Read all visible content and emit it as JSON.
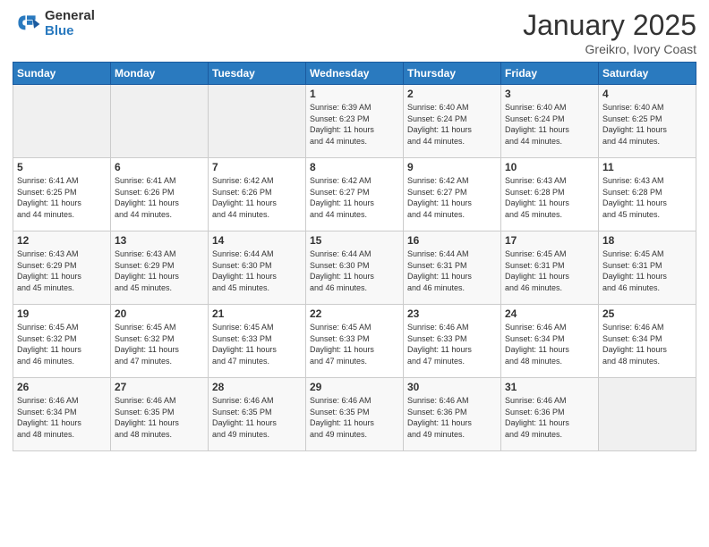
{
  "logo": {
    "general": "General",
    "blue": "Blue"
  },
  "header": {
    "month": "January 2025",
    "location": "Greikro, Ivory Coast"
  },
  "weekdays": [
    "Sunday",
    "Monday",
    "Tuesday",
    "Wednesday",
    "Thursday",
    "Friday",
    "Saturday"
  ],
  "weeks": [
    [
      {
        "day": "",
        "info": ""
      },
      {
        "day": "",
        "info": ""
      },
      {
        "day": "",
        "info": ""
      },
      {
        "day": "1",
        "info": "Sunrise: 6:39 AM\nSunset: 6:23 PM\nDaylight: 11 hours\nand 44 minutes."
      },
      {
        "day": "2",
        "info": "Sunrise: 6:40 AM\nSunset: 6:24 PM\nDaylight: 11 hours\nand 44 minutes."
      },
      {
        "day": "3",
        "info": "Sunrise: 6:40 AM\nSunset: 6:24 PM\nDaylight: 11 hours\nand 44 minutes."
      },
      {
        "day": "4",
        "info": "Sunrise: 6:40 AM\nSunset: 6:25 PM\nDaylight: 11 hours\nand 44 minutes."
      }
    ],
    [
      {
        "day": "5",
        "info": "Sunrise: 6:41 AM\nSunset: 6:25 PM\nDaylight: 11 hours\nand 44 minutes."
      },
      {
        "day": "6",
        "info": "Sunrise: 6:41 AM\nSunset: 6:26 PM\nDaylight: 11 hours\nand 44 minutes."
      },
      {
        "day": "7",
        "info": "Sunrise: 6:42 AM\nSunset: 6:26 PM\nDaylight: 11 hours\nand 44 minutes."
      },
      {
        "day": "8",
        "info": "Sunrise: 6:42 AM\nSunset: 6:27 PM\nDaylight: 11 hours\nand 44 minutes."
      },
      {
        "day": "9",
        "info": "Sunrise: 6:42 AM\nSunset: 6:27 PM\nDaylight: 11 hours\nand 44 minutes."
      },
      {
        "day": "10",
        "info": "Sunrise: 6:43 AM\nSunset: 6:28 PM\nDaylight: 11 hours\nand 45 minutes."
      },
      {
        "day": "11",
        "info": "Sunrise: 6:43 AM\nSunset: 6:28 PM\nDaylight: 11 hours\nand 45 minutes."
      }
    ],
    [
      {
        "day": "12",
        "info": "Sunrise: 6:43 AM\nSunset: 6:29 PM\nDaylight: 11 hours\nand 45 minutes."
      },
      {
        "day": "13",
        "info": "Sunrise: 6:43 AM\nSunset: 6:29 PM\nDaylight: 11 hours\nand 45 minutes."
      },
      {
        "day": "14",
        "info": "Sunrise: 6:44 AM\nSunset: 6:30 PM\nDaylight: 11 hours\nand 45 minutes."
      },
      {
        "day": "15",
        "info": "Sunrise: 6:44 AM\nSunset: 6:30 PM\nDaylight: 11 hours\nand 46 minutes."
      },
      {
        "day": "16",
        "info": "Sunrise: 6:44 AM\nSunset: 6:31 PM\nDaylight: 11 hours\nand 46 minutes."
      },
      {
        "day": "17",
        "info": "Sunrise: 6:45 AM\nSunset: 6:31 PM\nDaylight: 11 hours\nand 46 minutes."
      },
      {
        "day": "18",
        "info": "Sunrise: 6:45 AM\nSunset: 6:31 PM\nDaylight: 11 hours\nand 46 minutes."
      }
    ],
    [
      {
        "day": "19",
        "info": "Sunrise: 6:45 AM\nSunset: 6:32 PM\nDaylight: 11 hours\nand 46 minutes."
      },
      {
        "day": "20",
        "info": "Sunrise: 6:45 AM\nSunset: 6:32 PM\nDaylight: 11 hours\nand 47 minutes."
      },
      {
        "day": "21",
        "info": "Sunrise: 6:45 AM\nSunset: 6:33 PM\nDaylight: 11 hours\nand 47 minutes."
      },
      {
        "day": "22",
        "info": "Sunrise: 6:45 AM\nSunset: 6:33 PM\nDaylight: 11 hours\nand 47 minutes."
      },
      {
        "day": "23",
        "info": "Sunrise: 6:46 AM\nSunset: 6:33 PM\nDaylight: 11 hours\nand 47 minutes."
      },
      {
        "day": "24",
        "info": "Sunrise: 6:46 AM\nSunset: 6:34 PM\nDaylight: 11 hours\nand 48 minutes."
      },
      {
        "day": "25",
        "info": "Sunrise: 6:46 AM\nSunset: 6:34 PM\nDaylight: 11 hours\nand 48 minutes."
      }
    ],
    [
      {
        "day": "26",
        "info": "Sunrise: 6:46 AM\nSunset: 6:34 PM\nDaylight: 11 hours\nand 48 minutes."
      },
      {
        "day": "27",
        "info": "Sunrise: 6:46 AM\nSunset: 6:35 PM\nDaylight: 11 hours\nand 48 minutes."
      },
      {
        "day": "28",
        "info": "Sunrise: 6:46 AM\nSunset: 6:35 PM\nDaylight: 11 hours\nand 49 minutes."
      },
      {
        "day": "29",
        "info": "Sunrise: 6:46 AM\nSunset: 6:35 PM\nDaylight: 11 hours\nand 49 minutes."
      },
      {
        "day": "30",
        "info": "Sunrise: 6:46 AM\nSunset: 6:36 PM\nDaylight: 11 hours\nand 49 minutes."
      },
      {
        "day": "31",
        "info": "Sunrise: 6:46 AM\nSunset: 6:36 PM\nDaylight: 11 hours\nand 49 minutes."
      },
      {
        "day": "",
        "info": ""
      }
    ]
  ]
}
